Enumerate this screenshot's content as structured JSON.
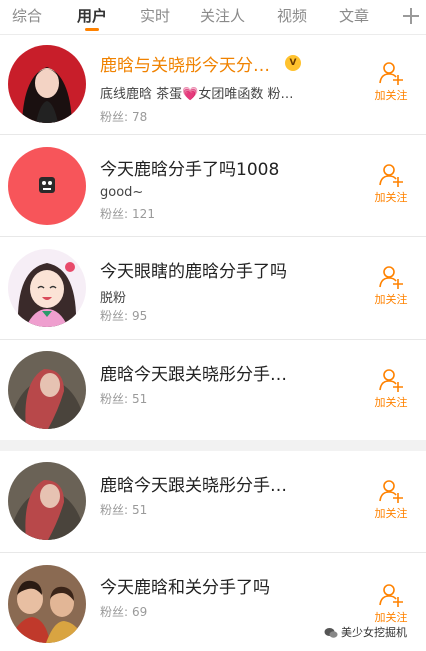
{
  "tabs": [
    "综合",
    "用户",
    "实时",
    "关注人",
    "视频",
    "文章"
  ],
  "active_tab": "用户",
  "accent_color": "#ff8200",
  "users": [
    {
      "name": "鹿晗与关晓彤今天分…",
      "vip_badge": true,
      "desc_before": "底线鹿晗 茶蛋",
      "desc_heart": "💗",
      "desc_after": "女团唯函数 粉…",
      "fans_label": "粉丝:",
      "fans_count": "78",
      "follow_label": "加关注",
      "avatar": "photo-girl-dark-hair"
    },
    {
      "name": "今天鹿晗分手了吗1008",
      "desc": "good~",
      "fans_label": "粉丝:",
      "fans_count": "121",
      "follow_label": "加关注",
      "avatar": "red-circle-cartoon"
    },
    {
      "name": "今天眼瞎的鹿晗分手了吗",
      "desc": "脱粉",
      "fans_label": "粉丝:",
      "fans_count": "95",
      "follow_label": "加关注",
      "avatar": "anime-girl"
    },
    {
      "name": "鹿晗今天跟关晓彤分手…",
      "fans_label": "粉丝:",
      "fans_count": "51",
      "follow_label": "加关注",
      "avatar": "photo-red-hair"
    },
    {
      "name": "鹿晗今天跟关晓彤分手…",
      "fans_label": "粉丝:",
      "fans_count": "51",
      "follow_label": "加关注",
      "avatar": "photo-red-hair"
    },
    {
      "name": "今天鹿晗和关分手了吗",
      "fans_label": "粉丝:",
      "fans_count": "69",
      "follow_label": "加关注",
      "avatar": "photo-crowd"
    }
  ],
  "watermark": "美少女挖掘机"
}
